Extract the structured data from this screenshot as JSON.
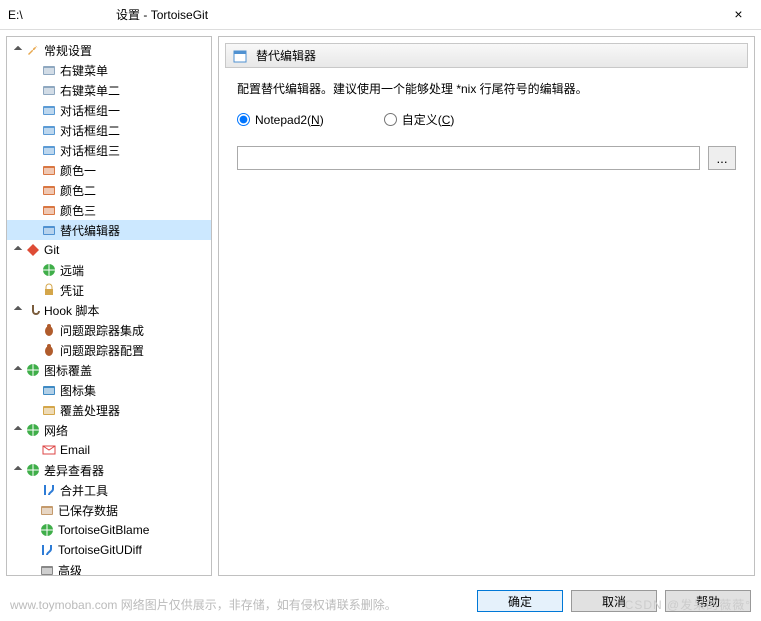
{
  "window": {
    "title_prefix": "E:\\",
    "title_suffix": "设置 - TortoiseGit",
    "close": "×"
  },
  "tree": [
    {
      "level": 0,
      "expand": "open",
      "icon": "wrench",
      "label": "常规设置",
      "sel": false
    },
    {
      "level": 1,
      "expand": "",
      "icon": "gear",
      "label": "右键菜单",
      "sel": false
    },
    {
      "level": 1,
      "expand": "",
      "icon": "gear",
      "label": "右键菜单二",
      "sel": false
    },
    {
      "level": 1,
      "expand": "",
      "icon": "dialogs",
      "label": "对话框组一",
      "sel": false
    },
    {
      "level": 1,
      "expand": "",
      "icon": "dialogs",
      "label": "对话框组二",
      "sel": false
    },
    {
      "level": 1,
      "expand": "",
      "icon": "dialogs",
      "label": "对话框组三",
      "sel": false
    },
    {
      "level": 1,
      "expand": "",
      "icon": "colors",
      "label": "颜色一",
      "sel": false
    },
    {
      "level": 1,
      "expand": "",
      "icon": "colors",
      "label": "颜色二",
      "sel": false
    },
    {
      "level": 1,
      "expand": "",
      "icon": "colors",
      "label": "颜色三",
      "sel": false
    },
    {
      "level": 1,
      "expand": "",
      "icon": "editor",
      "label": "替代编辑器",
      "sel": true
    },
    {
      "level": 0,
      "expand": "open",
      "icon": "git",
      "label": "Git",
      "sel": false
    },
    {
      "level": 1,
      "expand": "",
      "icon": "globe",
      "label": "远端",
      "sel": false
    },
    {
      "level": 1,
      "expand": "",
      "icon": "lock",
      "label": "凭证",
      "sel": false
    },
    {
      "level": 0,
      "expand": "open",
      "icon": "hook",
      "label": "Hook 脚本",
      "sel": false
    },
    {
      "level": 1,
      "expand": "",
      "icon": "bug",
      "label": "问题跟踪器集成",
      "sel": false
    },
    {
      "level": 1,
      "expand": "",
      "icon": "bug",
      "label": "问题跟踪器配置",
      "sel": false
    },
    {
      "level": 0,
      "expand": "open",
      "icon": "overlay",
      "label": "图标覆盖",
      "sel": false
    },
    {
      "level": 1,
      "expand": "",
      "icon": "iconset",
      "label": "图标集",
      "sel": false
    },
    {
      "level": 1,
      "expand": "",
      "icon": "handler",
      "label": "覆盖处理器",
      "sel": false
    },
    {
      "level": 0,
      "expand": "open",
      "icon": "network",
      "label": "网络",
      "sel": false
    },
    {
      "level": 1,
      "expand": "",
      "icon": "email",
      "label": "Email",
      "sel": false
    },
    {
      "level": 0,
      "expand": "open",
      "icon": "diff",
      "label": "差异查看器",
      "sel": false
    },
    {
      "level": 1,
      "expand": "",
      "icon": "merge",
      "label": "合并工具",
      "sel": false
    },
    {
      "level": 0,
      "expand": "",
      "icon": "saved",
      "label": "已保存数据",
      "sel": false
    },
    {
      "level": 0,
      "expand": "",
      "icon": "blame",
      "label": "TortoiseGitBlame",
      "sel": false
    },
    {
      "level": 0,
      "expand": "",
      "icon": "udiff",
      "label": "TortoiseGitUDiff",
      "sel": false
    },
    {
      "level": 0,
      "expand": "",
      "icon": "advanced",
      "label": "高级",
      "sel": false
    }
  ],
  "panel": {
    "header": "替代编辑器",
    "desc": "配置替代编辑器。建议使用一个能够处理 *nix 行尾符号的编辑器。",
    "radio1_label": "Notepad2(",
    "radio1_key": "N",
    "radio1_close": ")",
    "radio2_label": "自定义(",
    "radio2_key": "C",
    "radio2_close": ")",
    "browse": "...",
    "path_value": ""
  },
  "buttons": {
    "ok": "确定",
    "cancel": "取消",
    "help": "帮助"
  },
  "watermark": {
    "left": "www.toymoban.com 网络图片仅供展示，非存储，如有侵权请联系删除。",
    "right": "CSDN @发呆的薇薇°"
  },
  "icons": {
    "wrench": "#e8a84f",
    "gear": "#8fa8c0",
    "dialogs": "#5b9bd5",
    "colors": "#d97742",
    "editor": "#4f91d1",
    "git": "#de4c36",
    "globe": "#3fae49",
    "lock": "#d4a64a",
    "hook": "#7a5c3c",
    "bug": "#b05c2c",
    "overlay": "#3fae49",
    "iconset": "#3f8ac4",
    "handler": "#d4a64a",
    "network": "#3fae49",
    "email": "#d44",
    "diff": "#3fae49",
    "merge": "#2e7cd6",
    "saved": "#c49a6c",
    "blame": "#3fae49",
    "udiff": "#2e7cd6",
    "advanced": "#888"
  }
}
